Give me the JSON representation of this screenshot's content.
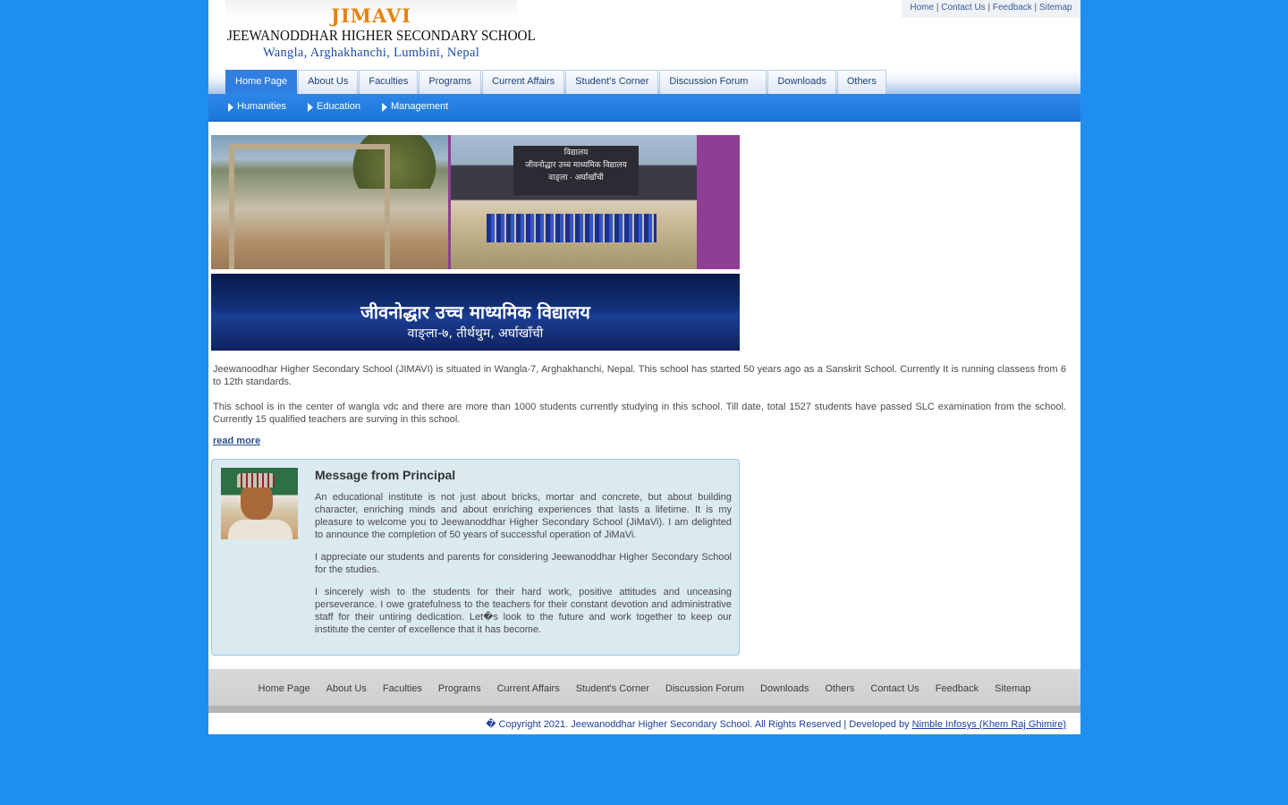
{
  "logo": {
    "abbr": "JIMAVI",
    "name": "JEEWANODDHAR HIGHER SECONDARY SCHOOL",
    "location": "Wangla, Arghakhanchi, Lumbini, Nepal"
  },
  "toplinks": [
    "Home",
    "Contact Us",
    "Feedback",
    "Sitemap"
  ],
  "nav": [
    "Home Page",
    "About Us",
    "Faculties",
    "Programs",
    "Current Affairs",
    "Student's Corner",
    "Discussion Forum",
    "Downloads",
    "Others"
  ],
  "subnav": [
    "Humanities",
    "Education",
    "Management"
  ],
  "photo": {
    "sign_text": "विद्यालय\nजीवनोद्धार उच्च माध्यमिक विद्यालय\nवाङ्‌ला · अर्घाखाँची"
  },
  "banner": {
    "line1": "जीवनोद्धार उच्च माध्यमिक विद्यालय",
    "line2": "वाङ्‌ला-७, तीर्थथुम, अर्घाखाँची"
  },
  "intro": {
    "p1": "Jeewanoodhar Higher Secondary School (JIMAVI) is situated in Wangla-7, Arghakhanchi, Nepal. This school has started 50 years ago as a Sanskrit School. Currently It is running classess from 6 to 12th standards.",
    "p2": "This school is in the center of wangla vdc and there are more than 1000 students currently studying in this school. Till date, total 1527 students have passed SLC examination from the school. Currently 15 qualified teachers are surving in this school.",
    "read_more": "read more"
  },
  "principal": {
    "title": "Message from Principal",
    "p1": "An educational institute is not just about bricks, mortar and concrete, but about building character, enriching minds and about enriching experiences that lasts a lifetime. It is my pleasure to welcome you to Jeewanoddhar Higher Secondary School (JiMaVi). I am delighted to announce the completion of 50 years of successful operation of JiMaVi.",
    "p2": "I appreciate our students and parents for considering Jeewanoddhar Higher Secondary School for the studies.",
    "p3": "I sincerely wish to the students for their hard work, positive attitudes and unceasing perseverance. I owe gratefulness to the teachers for their constant devotion and administrative staff for their untiring dedication. Let�s look to the future and work together to keep our institute the center of excellence that it has become."
  },
  "footer_links": [
    "Home Page",
    "About Us",
    "Faculties",
    "Programs",
    "Current Affairs",
    "Student's Corner",
    "Discussion Forum",
    "Downloads",
    "Others",
    "Contact Us",
    "Feedback",
    "Sitemap"
  ],
  "copyright": {
    "text": "� Copyright 2021. Jeewanoddhar Higher Secondary School. All Rights Reserved | Developed by ",
    "developer": "Nimble Infosys (Khem Raj Ghimire)"
  },
  "colors": {
    "page_bg": "#1f8ef1",
    "nav_active": "#2f7fe0",
    "subnav_bg": "#2d87e8",
    "logo_accent": "#e8820c",
    "panel_bg": "#dbe9f1"
  }
}
